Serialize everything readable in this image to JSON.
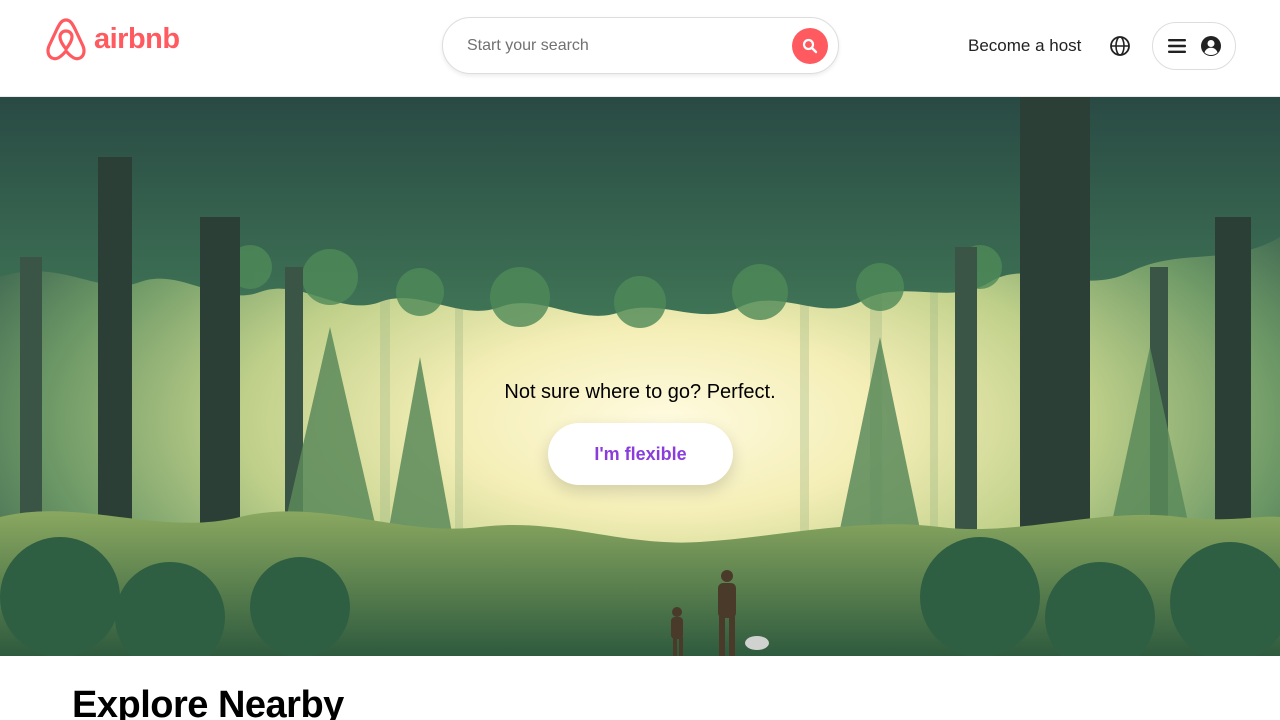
{
  "brand": {
    "name": "airbnb",
    "color": "#FF5A5F"
  },
  "search": {
    "placeholder": "Start your search",
    "button_icon": "search-icon"
  },
  "nav": {
    "host_label": "Become a host",
    "globe_icon": "globe-icon",
    "menu_icon": "hamburger-icon",
    "avatar_icon": "user-avatar-icon"
  },
  "hero": {
    "tagline": "Not sure where to go? Perfect.",
    "cta_label": "I'm flexible",
    "cta_color": "#8B3DDC"
  },
  "explore": {
    "title": "Explore Nearby"
  }
}
